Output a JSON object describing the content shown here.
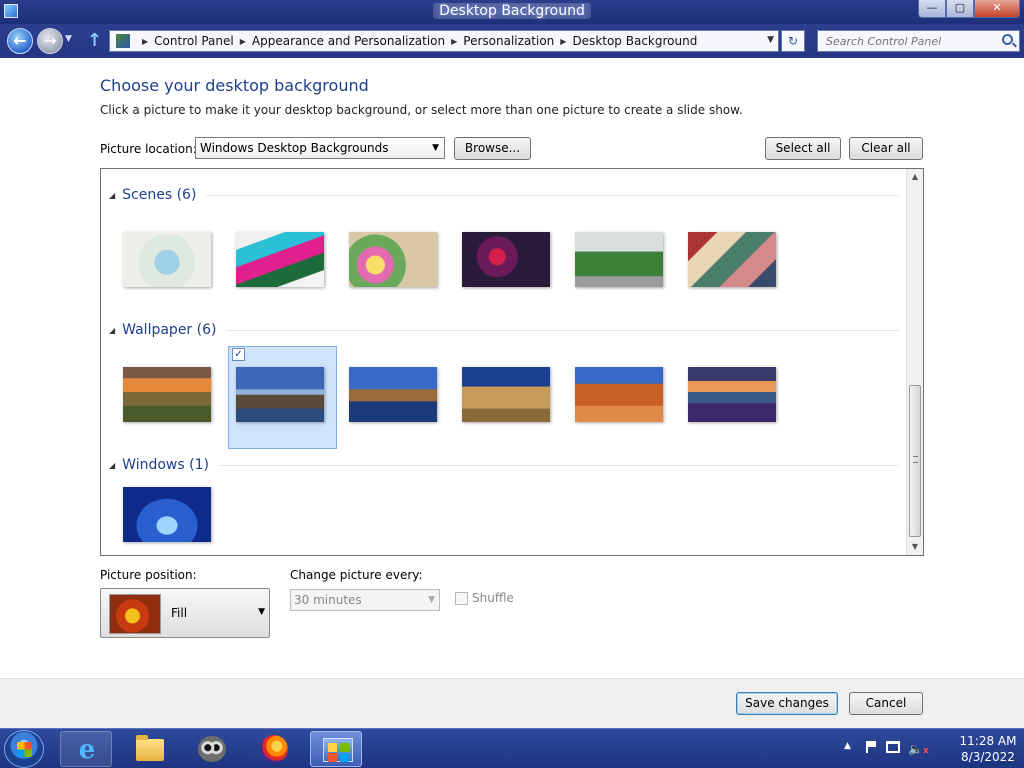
{
  "window": {
    "title": "Desktop Background",
    "controls": {
      "minimize": "—",
      "maximize": "▢",
      "close": "✕"
    }
  },
  "address_bar": {
    "breadcrumbs": [
      "Control Panel",
      "Appearance and Personalization",
      "Personalization",
      "Desktop Background"
    ],
    "search_placeholder": "Search Control Panel"
  },
  "page": {
    "heading": "Choose your desktop background",
    "subtext": "Click a picture to make it your desktop background, or select more than one picture to create a slide show.",
    "picture_location_label": "Picture location:",
    "picture_location_value": "Windows Desktop Backgrounds",
    "browse_label": "Browse...",
    "select_all_label": "Select all",
    "clear_all_label": "Clear all"
  },
  "groups": [
    {
      "name": "Scenes (6)",
      "thumbs": [
        {
          "label": "scene-1",
          "selected": false,
          "bg": "radial-gradient(circle at 50% 55%, #9ed0e8 0 12px, #dfe9df 13px 28px, #eeeeea 29px)"
        },
        {
          "label": "scene-2",
          "selected": false,
          "bg": "linear-gradient(160deg,#f0f0f0 0 20%, #2ac0d6 21% 40%, #e0208c 41% 60%, #1d6a3a 61% 80%, #f4f4f4 81%)"
        },
        {
          "label": "scene-3",
          "selected": false,
          "bg": "radial-gradient(circle at 30% 60%, #f7e06a 0 9px, #e36ab1 10px 18px, #6aa85a 19px 30px, #d9c7a8 31px)"
        },
        {
          "label": "scene-4",
          "selected": false,
          "bg": "radial-gradient(circle at 40% 45%, #d4204a 0 8px, #6b1a5a 9px 20px, #2b1b3a 21px)"
        },
        {
          "label": "scene-5",
          "selected": false,
          "bg": "linear-gradient(#d9dfdf 0 35%, #3e7f3a 36% 80%, #9c9c9c 81%)"
        },
        {
          "label": "scene-6",
          "selected": false,
          "bg": "linear-gradient(135deg,#a33 0 20%, #e9d6b3 21% 40%, #4a7d6a 41% 60%, #d48a8a 61% 80%, #3a4a6a 81%)"
        }
      ]
    },
    {
      "name": "Wallpaper (6)",
      "thumbs": [
        {
          "label": "wallpaper-1",
          "selected": false,
          "bg": "linear-gradient(#7c5a4a 0 20%, #e58a3a 21% 45%, #7a6a3a 46% 70%, #4a5a2a 71%)"
        },
        {
          "label": "wallpaper-2",
          "selected": true,
          "bg": "linear-gradient(#3d66b6 0 40%, #8fb0d8 41% 50%, #5a4a3a 51% 75%, #2a4a7a 76%)"
        },
        {
          "label": "wallpaper-3",
          "selected": false,
          "bg": "linear-gradient(#3a6ac8 0 40%, #9a6a3a 41% 62%, #1a3a7a 63%)"
        },
        {
          "label": "wallpaper-4",
          "selected": false,
          "bg": "linear-gradient(#1d3f8f 0 35%, #c89a5a 36% 75%, #8a6a3a 76%)"
        },
        {
          "label": "wallpaper-5",
          "selected": false,
          "bg": "linear-gradient(#3a6ac8 0 30%, #c8602a 31% 70%, #e08a4a 71%)"
        },
        {
          "label": "wallpaper-6",
          "selected": false,
          "bg": "linear-gradient(#3a3a6a 0 25%, #e89a5a 26% 45%, #3a5a8a 46% 65%, #3a2a6a 66%)"
        }
      ]
    },
    {
      "name": "Windows (1)",
      "thumbs": [
        {
          "label": "windows-1",
          "selected": false,
          "bg": "radial-gradient(ellipse at 50% 70%, #9fd4ff 0 10px, #2a5fd0 11px 30px, #0e2a8a 31px)"
        }
      ]
    }
  ],
  "position": {
    "label": "Picture position:",
    "value": "Fill"
  },
  "interval": {
    "label": "Change picture every:",
    "value": "30 minutes",
    "shuffle_label": "Shuffle"
  },
  "footer": {
    "save_label": "Save changes",
    "cancel_label": "Cancel"
  },
  "taskbar": {
    "time": "11:28 AM",
    "date": "8/3/2022",
    "apps": [
      "internet-explorer-icon",
      "file-explorer-icon",
      "raccoon-app-icon",
      "firefox-icon",
      "control-panel-icon"
    ]
  }
}
